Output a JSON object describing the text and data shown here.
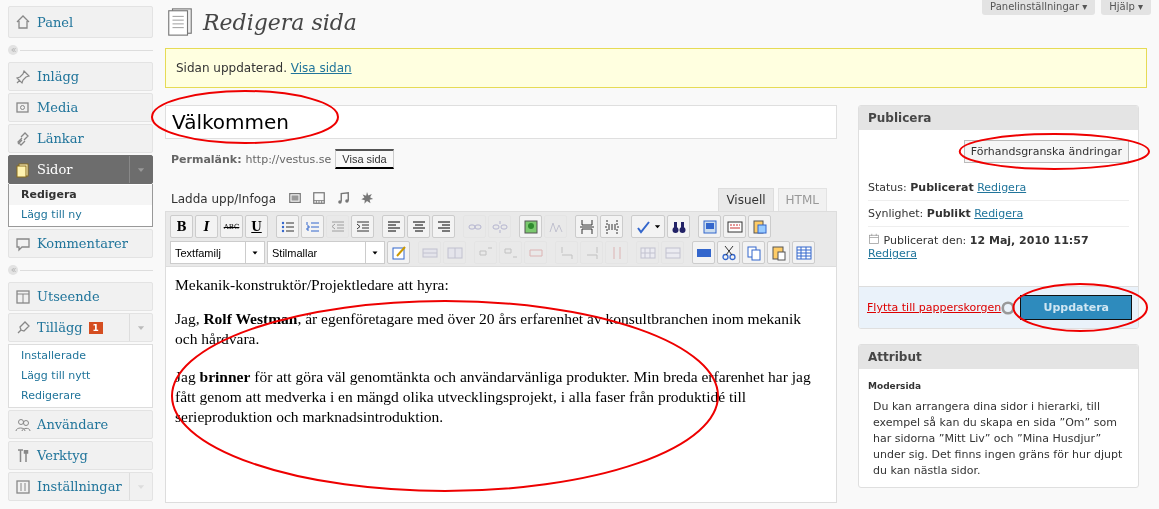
{
  "header_links": [
    {
      "label": "Panelinställningar ▾"
    },
    {
      "label": "Hjälp ▾"
    }
  ],
  "sidebar": {
    "items": [
      {
        "kind": "item",
        "label": "Panel",
        "selected": false,
        "toggle": false
      },
      {
        "kind": "separator"
      },
      {
        "kind": "item",
        "label": "Inlägg",
        "selected": false,
        "toggle": false
      },
      {
        "kind": "item",
        "label": "Media",
        "selected": false,
        "toggle": false
      },
      {
        "kind": "item",
        "label": "Länkar",
        "selected": false,
        "toggle": false
      },
      {
        "kind": "item",
        "label": "Sidor",
        "selected": true,
        "toggle": true,
        "expanded": true,
        "children": [
          {
            "label": "Redigera",
            "selected": true
          },
          {
            "label": "Lägg till ny",
            "selected": false
          }
        ]
      },
      {
        "kind": "item",
        "label": "Kommentarer",
        "selected": false,
        "toggle": false
      },
      {
        "kind": "separator"
      },
      {
        "kind": "item",
        "label": "Utseende",
        "selected": false,
        "toggle": false
      },
      {
        "kind": "item",
        "label": "Tillägg",
        "badge": "1",
        "selected": false,
        "toggle": true,
        "expanded": true,
        "children": [
          {
            "label": "Installerade",
            "selected": false
          },
          {
            "label": "Lägg till nytt",
            "selected": false
          },
          {
            "label": "Redigerare",
            "selected": false
          }
        ]
      },
      {
        "kind": "item",
        "label": "Användare",
        "selected": false,
        "toggle": false
      },
      {
        "kind": "item",
        "label": "Verktyg",
        "selected": false,
        "toggle": false
      },
      {
        "kind": "item",
        "label": "Inställningar",
        "selected": false,
        "toggle": true,
        "expanded": false
      }
    ]
  },
  "page_title": "Redigera sida",
  "notice": {
    "text": "Sidan uppdaterad.",
    "link": "Visa sidan"
  },
  "title_field": {
    "value": "Välkommen"
  },
  "permalink": {
    "label": "Permalänk:",
    "url": "http://vestus.se",
    "button": "Visa sida"
  },
  "upload": {
    "label": "Ladda upp/Infoga"
  },
  "editor_tabs": [
    {
      "label": "Visuell",
      "selected": true
    },
    {
      "label": "HTML",
      "selected": false
    }
  ],
  "toolbar_rows": [
    [
      [
        {
          "kind": "letter",
          "label": "B",
          "disabled": false
        },
        {
          "kind": "letter",
          "label": "I",
          "disabled": false
        },
        {
          "kind": "letter",
          "label": "ABC",
          "disabled": false
        },
        {
          "kind": "letter",
          "label": "U",
          "disabled": false
        }
      ],
      [
        {
          "kind": "icon",
          "disabled": false
        },
        {
          "kind": "icon",
          "disabled": false
        },
        {
          "kind": "icon",
          "disabled": true
        },
        {
          "kind": "icon",
          "disabled": false
        }
      ],
      [
        {
          "kind": "icon",
          "disabled": false
        },
        {
          "kind": "icon",
          "disabled": false
        },
        {
          "kind": "icon",
          "disabled": false
        }
      ],
      [
        {
          "kind": "icon",
          "disabled": true
        },
        {
          "kind": "icon",
          "disabled": true
        }
      ],
      [
        {
          "kind": "icon",
          "disabled": false
        },
        {
          "kind": "icon",
          "disabled": true
        }
      ],
      [
        {
          "kind": "icon",
          "disabled": false
        },
        {
          "kind": "icon",
          "disabled": false
        }
      ],
      [
        {
          "kind": "split",
          "disabled": false
        },
        {
          "kind": "icon",
          "disabled": false
        }
      ],
      [
        {
          "kind": "icon",
          "disabled": false
        },
        {
          "kind": "icon",
          "disabled": false
        },
        {
          "kind": "icon",
          "disabled": false
        }
      ]
    ],
    [
      [
        {
          "kind": "select",
          "label": "Textfamilj"
        },
        {
          "kind": "select",
          "label": "Stilmallar"
        },
        {
          "kind": "icon",
          "disabled": false
        }
      ],
      [
        {
          "kind": "icon",
          "disabled": true
        },
        {
          "kind": "icon",
          "disabled": true
        }
      ],
      [
        {
          "kind": "icon",
          "disabled": true
        },
        {
          "kind": "icon",
          "disabled": true
        },
        {
          "kind": "icon",
          "disabled": true
        }
      ],
      [
        {
          "kind": "icon",
          "disabled": true
        },
        {
          "kind": "icon",
          "disabled": true
        },
        {
          "kind": "icon",
          "disabled": true
        }
      ],
      [
        {
          "kind": "icon",
          "disabled": true
        },
        {
          "kind": "icon",
          "disabled": true
        }
      ],
      [
        {
          "kind": "icon",
          "disabled": false
        },
        {
          "kind": "icon",
          "disabled": false
        },
        {
          "kind": "icon",
          "disabled": false
        },
        {
          "kind": "icon",
          "disabled": false
        },
        {
          "kind": "icon",
          "disabled": false
        }
      ]
    ]
  ],
  "content": [
    "Mekanik-konstruktör/Projektledare att hyra:",
    "Jag, **Rolf Westman**, är egenföretagare med över 20 års erfarenhet av konsultbranchen inom mekanik och hårdvara.",
    "Jag **brinner** för att göra väl genomtänkta och användarvänliga produkter. Min breda erfarenhet har jag fått genom att medverka i en mängd olika utvecklingsprojekt, i alla faser från produktidé till serieproduktion och marknadsintroduktion."
  ],
  "publish_box": {
    "title": "Publicera",
    "preview_button": "Förhandsgranska ändringar",
    "rows": [
      {
        "label": "Status:",
        "value": "Publicerat",
        "link": "Redigera"
      },
      {
        "label": "Synlighet:",
        "value": "Publikt",
        "link": "Redigera"
      },
      {
        "label": "Publicerat den:",
        "value": "12 Maj, 2010 11:57",
        "link": "Redigera"
      }
    ],
    "trash_link": "Flytta till papperskorgen",
    "update_button": "Uppdatera"
  },
  "attributes_box": {
    "title": "Attribut",
    "parent_label": "Modersida",
    "help": "Du kan arrangera dina sidor i hierarki, till exempel så kan du skapa en sida ”Om” som har sidorna ”Mitt Liv” och ”Mina Husdjur” under sig. Det finns ingen gräns för hur djupt du kan nästla sidor."
  }
}
